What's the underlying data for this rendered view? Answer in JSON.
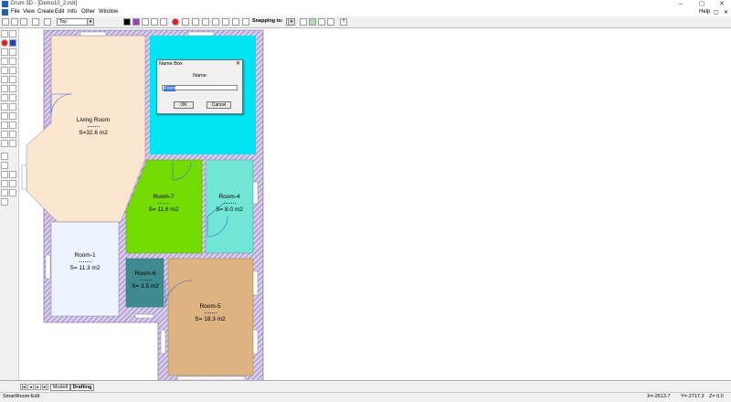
{
  "window": {
    "title": "Drum 3D - [Demo10_2.ndr]",
    "minimize": "–",
    "maximize": "▢",
    "close": "✕"
  },
  "menu": {
    "items": [
      "File",
      "View",
      "Create",
      "Edit",
      "Info",
      "Other",
      "Window"
    ],
    "help": "Help",
    "restore": "▢",
    "close": "✕"
  },
  "toolbar": {
    "view_select": "Top",
    "snapping_label": "Snapping to:",
    "help_label": "?"
  },
  "rooms": {
    "living": {
      "name": "Living Room",
      "area": "S=32.6 m2",
      "color": "#fde6d0"
    },
    "room1": {
      "name": "Room-1",
      "area": "S= 11.3 m2",
      "color": "#eef4ff"
    },
    "room7": {
      "name": "Room-7",
      "area": "S= 11.6 m2",
      "color": "#74dc00"
    },
    "room4": {
      "name": "Room-4",
      "area": "S= 8.0 m2",
      "color": "#72e6d6"
    },
    "room6": {
      "name": "Room-6",
      "area": "S= 3.5 m2",
      "color": "#3f8a8f"
    },
    "room5": {
      "name": "Room-5",
      "area": "S= 18.3 m2",
      "color": "#ddb382"
    },
    "cyan": {
      "color": "#00e5f3"
    }
  },
  "dialog": {
    "title": "Name Box",
    "close": "✕",
    "field_label": "Name",
    "value": "Room",
    "ok": "OK",
    "cancel": "Cancel"
  },
  "tabs": {
    "items": [
      "Modell",
      "Drafting"
    ],
    "active": "Drafting"
  },
  "status": {
    "mode": "SmartRoom:Edit",
    "x": "X=-2513.7",
    "y": "Y=-2717.3",
    "z": "Z= 0.0"
  }
}
